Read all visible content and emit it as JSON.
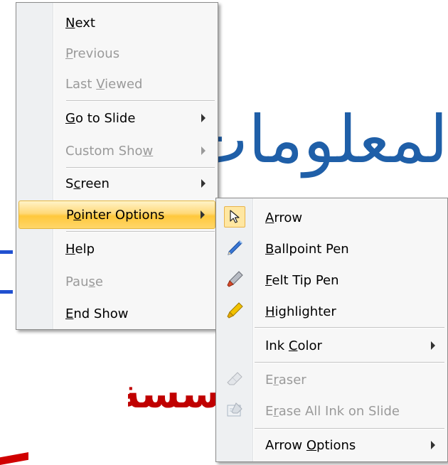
{
  "slide": {
    "title_fragment": "لمعلومات",
    "subtitle_fragment": "سسة"
  },
  "context_menu": {
    "items": [
      {
        "label": "Next",
        "mnemonic_index": 0,
        "disabled": false,
        "submenu": false
      },
      {
        "label": "Previous",
        "mnemonic_index": 0,
        "disabled": true,
        "submenu": false
      },
      {
        "label": "Last Viewed",
        "mnemonic_index": 5,
        "disabled": true,
        "submenu": false
      },
      {
        "label": "Go to Slide",
        "mnemonic_index": 0,
        "disabled": false,
        "submenu": true
      },
      {
        "label": "Custom Show",
        "mnemonic_index": 10,
        "disabled": true,
        "submenu": true
      },
      {
        "label": "Screen",
        "mnemonic_index": 1,
        "disabled": false,
        "submenu": true
      },
      {
        "label": "Pointer Options",
        "mnemonic_index": 1,
        "disabled": false,
        "submenu": true,
        "highlighted": true
      },
      {
        "label": "Help",
        "mnemonic_index": 0,
        "disabled": false,
        "submenu": false
      },
      {
        "label": "Pause",
        "mnemonic_index": 3,
        "disabled": true,
        "submenu": false
      },
      {
        "label": "End Show",
        "mnemonic_index": 0,
        "disabled": false,
        "submenu": false
      }
    ]
  },
  "pointer_submenu": {
    "items": [
      {
        "label": "Arrow",
        "icon": "arrow-pointer-icon",
        "checked": true,
        "disabled": false
      },
      {
        "label": "Ballpoint Pen",
        "icon": "ballpoint-pen-icon",
        "disabled": false
      },
      {
        "label": "Felt Tip Pen",
        "icon": "felt-tip-pen-icon",
        "disabled": false
      },
      {
        "label": "Highlighter",
        "icon": "highlighter-icon",
        "disabled": false
      },
      {
        "label": "Ink Color",
        "disabled": false,
        "submenu": true
      },
      {
        "label": "Eraser",
        "icon": "eraser-icon",
        "disabled": true
      },
      {
        "label": "Erase All Ink on Slide",
        "icon": "erase-all-ink-icon",
        "disabled": true
      },
      {
        "label": "Arrow Options",
        "disabled": false,
        "submenu": true
      }
    ]
  },
  "colors": {
    "highlight": "#ffc83c",
    "disabled_text": "#9a9a9a",
    "slide_blue": "#1f5fa8",
    "slide_red": "#c00000",
    "ballpoint_pen": "#3a78d6",
    "felt_tip_pen": "#d84a2a",
    "highlighter": "#f2c200"
  }
}
